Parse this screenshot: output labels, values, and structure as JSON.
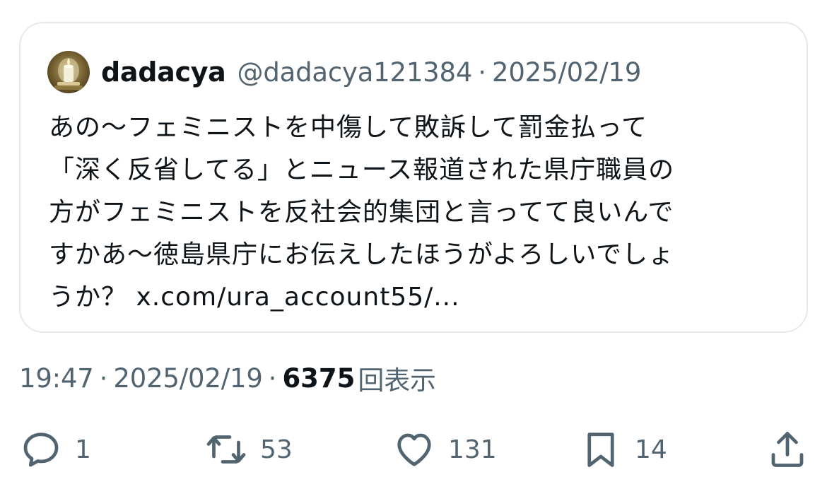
{
  "quoted_tweet": {
    "author_name": "dadacya",
    "author_handle": "@dadacya121384",
    "separator": "·",
    "date": "2025/02/19",
    "text_lines": [
      "あの〜フェミニストを中傷して敗訴して罰金払って",
      "「深く反省してる」とニュース報道された県庁職員の",
      "方がフェミニストを反社会的集団と言ってて良いんで",
      "すかあ〜徳島県庁にお伝えしたほうがよろしいでしょ",
      "うか？ x.com/ura_account55/..."
    ]
  },
  "meta": {
    "time": "19:47",
    "separator": "·",
    "date": "2025/02/19",
    "views_count": "6375",
    "views_label": "回表示"
  },
  "actions": {
    "reply": {
      "icon": "reply-icon",
      "count": "1"
    },
    "retweet": {
      "icon": "retweet-icon",
      "count": "53"
    },
    "like": {
      "icon": "heart-icon",
      "count": "131"
    },
    "bookmark": {
      "icon": "bookmark-icon",
      "count": "14"
    },
    "share": {
      "icon": "share-icon"
    }
  },
  "colors": {
    "text_primary": "#0f1419",
    "text_secondary": "#536471",
    "border": "#e6e9ec"
  }
}
